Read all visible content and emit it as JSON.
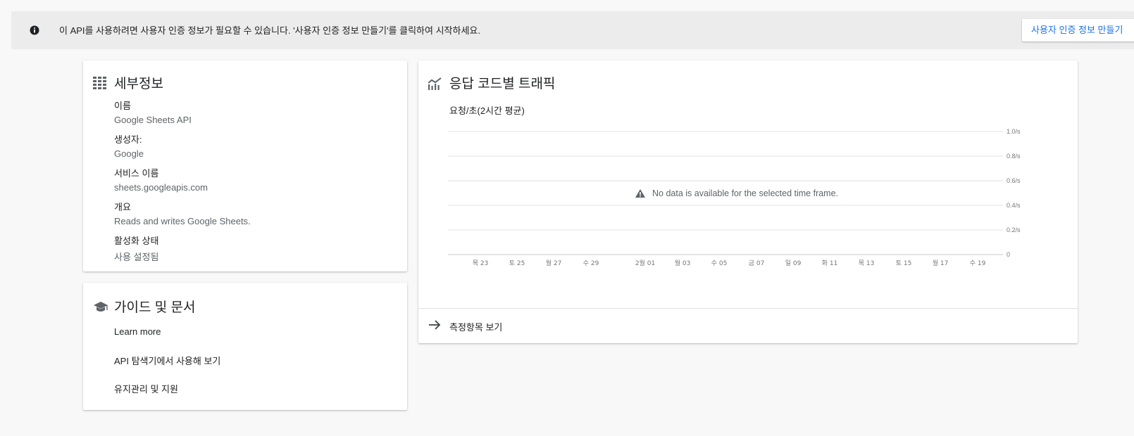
{
  "banner": {
    "icon": "info-icon",
    "message": "이 API를 사용하려면 사용자 인증 정보가 필요할 수 있습니다. '사용자 인증 정보 만들기'를 클릭하여 시작하세요.",
    "button_label": "사용자 인증 정보 만들기",
    "button_color": "#1a73e8"
  },
  "details": {
    "icon": "details-grid-icon",
    "title": "세부정보",
    "fields": [
      {
        "label": "이름",
        "value": "Google Sheets API"
      },
      {
        "label": "생성자:",
        "value": "Google"
      },
      {
        "label": "서비스 이름",
        "value": "sheets.googleapis.com"
      },
      {
        "label": "개요",
        "value": "Reads and writes Google Sheets."
      },
      {
        "label": "활성화 상태",
        "value": "사용 설정됨"
      }
    ]
  },
  "guides": {
    "icon": "graduation-cap-icon",
    "title": "가이드 및 문서",
    "links": [
      "Learn more",
      "API 탐색기에서 사용해 보기",
      "유지관리 및 지원"
    ]
  },
  "traffic": {
    "icon": "line-chart-icon",
    "title": "응답 코드별 트래픽",
    "subtitle": "요청/초(2시간 평균)",
    "footer_label": "측정항목 보기",
    "footer_icon": "arrow-right-icon"
  },
  "chart_data": {
    "type": "line",
    "title": "",
    "ylabel": "",
    "xlabel": "",
    "ylim": [
      0,
      1.0
    ],
    "y_ticks": [
      "1.0/s",
      "0.8/s",
      "0.6/s",
      "0.4/s",
      "0.2/s",
      "0"
    ],
    "x_ticks": [
      "목 23",
      "토 25",
      "월 27",
      "수 29",
      "2월 01",
      "월 03",
      "수 05",
      "금 07",
      "일 09",
      "화 11",
      "목 13",
      "토 15",
      "월 17",
      "수 19"
    ],
    "series": [],
    "empty_message": "No data is available for the selected time frame.",
    "grid": true,
    "gridline_color": "#e0e0e0",
    "tick_color": "#757575"
  }
}
